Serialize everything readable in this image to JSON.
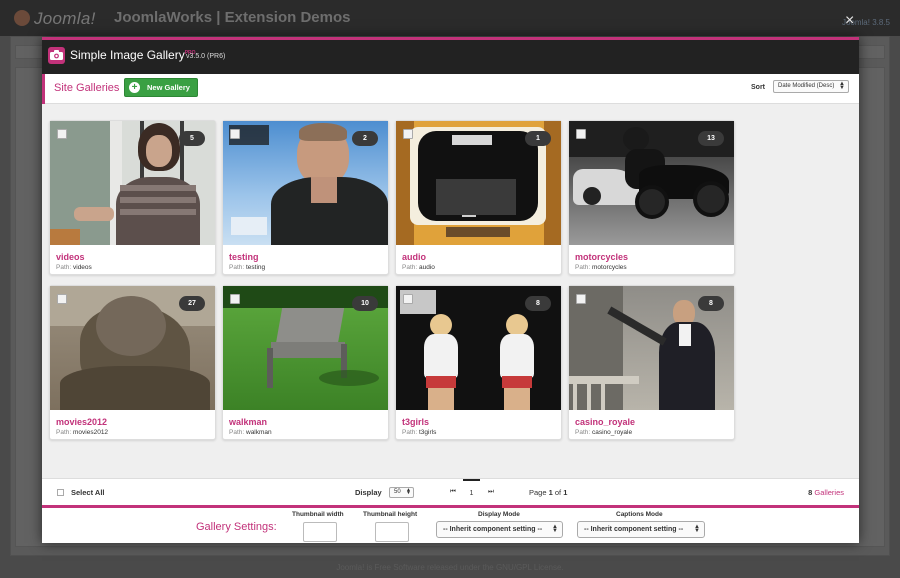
{
  "backdrop": {
    "brand": "Joomla!",
    "site_title": "JoomlaWorks | Extension Demos",
    "version": "Joomla! 3.8.5",
    "footer": "Joomla! is Free Software released under the GNU/GPL License."
  },
  "modal": {
    "close_icon": "×",
    "app_title": "Simple Image Gallery",
    "app_edition": "PRO",
    "app_version": "v3.5.0 (PR6)",
    "section_title": "Site Galleries",
    "new_gallery_label": "New Gallery",
    "sort_label": "Sort",
    "sort_value": "Date Modified (Desc)",
    "path_label": "Path:",
    "galleries": [
      {
        "title": "videos",
        "path": "videos",
        "count": "5"
      },
      {
        "title": "testing",
        "path": "testing",
        "count": "2"
      },
      {
        "title": "audio",
        "path": "audio",
        "count": "1"
      },
      {
        "title": "motorcycles",
        "path": "motorcycles",
        "count": "13"
      },
      {
        "title": "movies2012",
        "path": "movies2012",
        "count": "27"
      },
      {
        "title": "walkman",
        "path": "walkman",
        "count": "10"
      },
      {
        "title": "t3girls",
        "path": "t3girls",
        "count": "8"
      },
      {
        "title": "casino_royale",
        "path": "casino_royale",
        "count": "8"
      }
    ],
    "footer": {
      "select_all_label": "Select All",
      "display_label": "Display",
      "display_value": "50",
      "first_page_icon": "⏮",
      "current_page": "1",
      "last_page_icon": "⏭",
      "page_word": "Page",
      "page_current": "1",
      "page_of": "of",
      "page_total": "1",
      "galleries_total": "8",
      "galleries_word": "Galleries"
    },
    "settings": {
      "title": "Gallery Settings:",
      "thumb_width_label": "Thumbnail width",
      "thumb_height_label": "Thumbnail height",
      "display_mode_label": "Display Mode",
      "display_mode_value": "-- Inherit component setting --",
      "captions_mode_label": "Captions Mode",
      "captions_mode_value": "-- Inherit component setting --"
    }
  },
  "colors": {
    "accent": "#c2327a",
    "new_gallery_button": "#3aa043",
    "modal_header": "#222222"
  },
  "icons": {
    "app": "camera-icon",
    "new_gallery": "plus-circle-icon",
    "close": "close-icon",
    "pagination_first": "first-page-icon",
    "pagination_last": "last-page-icon",
    "select_arrows": "select-arrows-icon"
  }
}
